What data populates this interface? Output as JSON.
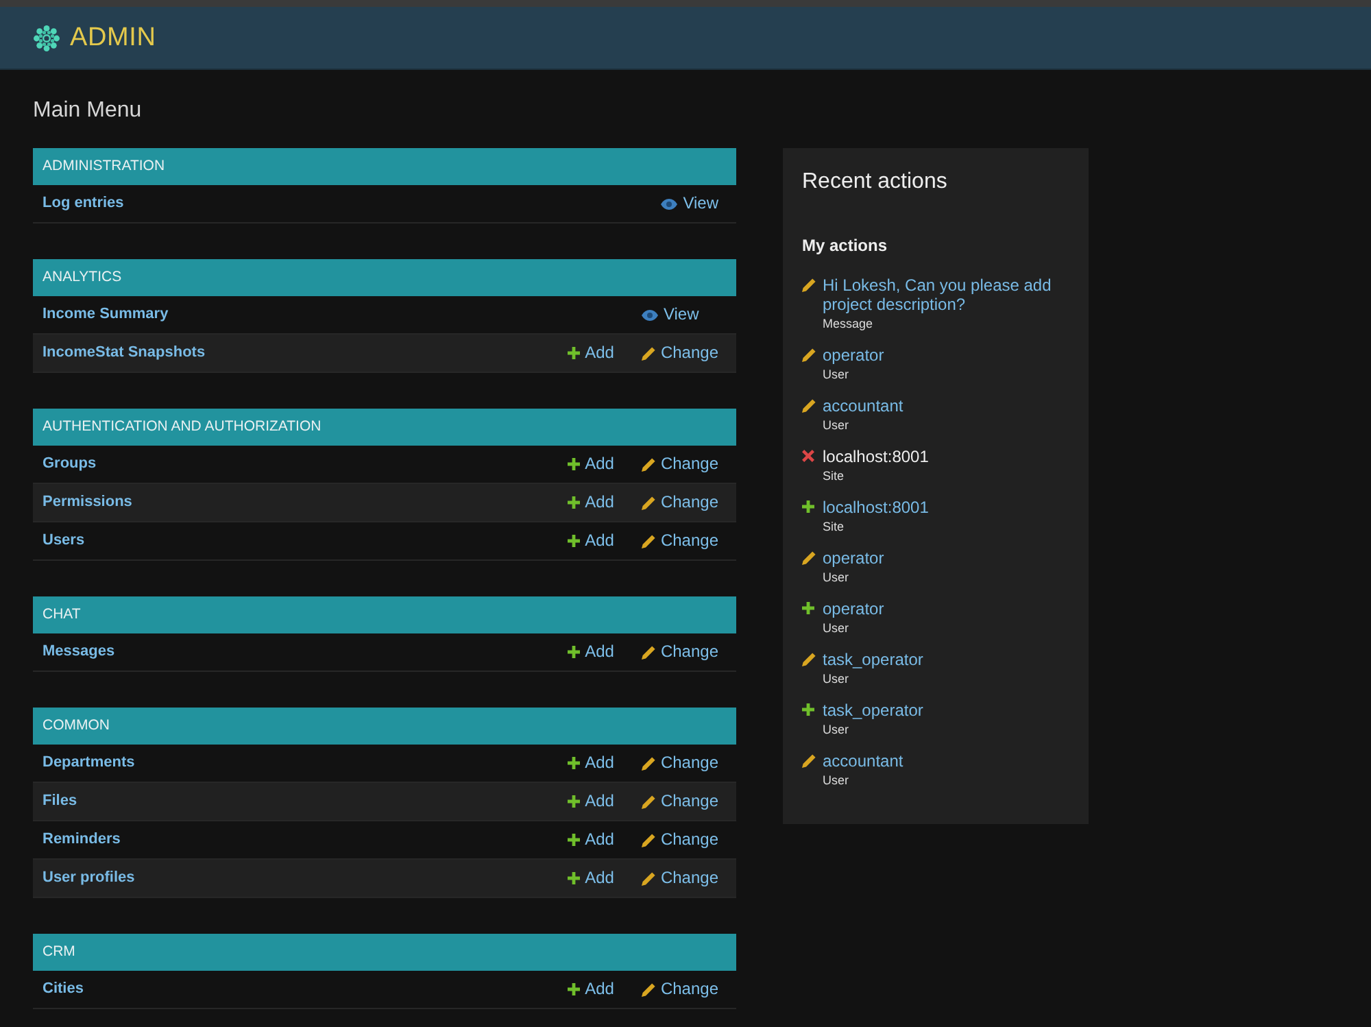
{
  "header": {
    "title": "ADMIN"
  },
  "page_title": "Main Menu",
  "modules": [
    {
      "caption": "ADMINISTRATION",
      "rows": [
        {
          "name": "Log entries",
          "actions": [
            {
              "kind": "view",
              "label": "View"
            }
          ]
        }
      ]
    },
    {
      "caption": "ANALYTICS",
      "rows": [
        {
          "name": "Income Summary",
          "actions": [
            {
              "kind": "view",
              "label": "View"
            }
          ]
        },
        {
          "name": "IncomeStat Snapshots",
          "actions": [
            {
              "kind": "add",
              "label": "Add"
            },
            {
              "kind": "change",
              "label": "Change"
            }
          ]
        }
      ]
    },
    {
      "caption": "AUTHENTICATION AND AUTHORIZATION",
      "rows": [
        {
          "name": "Groups",
          "actions": [
            {
              "kind": "add",
              "label": "Add"
            },
            {
              "kind": "change",
              "label": "Change"
            }
          ]
        },
        {
          "name": "Permissions",
          "actions": [
            {
              "kind": "add",
              "label": "Add"
            },
            {
              "kind": "change",
              "label": "Change"
            }
          ]
        },
        {
          "name": "Users",
          "actions": [
            {
              "kind": "add",
              "label": "Add"
            },
            {
              "kind": "change",
              "label": "Change"
            }
          ]
        }
      ]
    },
    {
      "caption": "CHAT",
      "rows": [
        {
          "name": "Messages",
          "actions": [
            {
              "kind": "add",
              "label": "Add"
            },
            {
              "kind": "change",
              "label": "Change"
            }
          ]
        }
      ]
    },
    {
      "caption": "COMMON",
      "rows": [
        {
          "name": "Departments",
          "actions": [
            {
              "kind": "add",
              "label": "Add"
            },
            {
              "kind": "change",
              "label": "Change"
            }
          ]
        },
        {
          "name": "Files",
          "actions": [
            {
              "kind": "add",
              "label": "Add"
            },
            {
              "kind": "change",
              "label": "Change"
            }
          ]
        },
        {
          "name": "Reminders",
          "actions": [
            {
              "kind": "add",
              "label": "Add"
            },
            {
              "kind": "change",
              "label": "Change"
            }
          ]
        },
        {
          "name": "User profiles",
          "actions": [
            {
              "kind": "add",
              "label": "Add"
            },
            {
              "kind": "change",
              "label": "Change"
            }
          ]
        }
      ]
    },
    {
      "caption": "CRM",
      "rows": [
        {
          "name": "Cities",
          "actions": [
            {
              "kind": "add",
              "label": "Add"
            },
            {
              "kind": "change",
              "label": "Change"
            }
          ]
        }
      ]
    }
  ],
  "recent_actions": {
    "title": "Recent actions",
    "subtitle": "My actions",
    "items": [
      {
        "kind": "change",
        "label": "Hi Lokesh, Can you please add project description?",
        "type": "Message"
      },
      {
        "kind": "change",
        "label": "operator",
        "type": "User"
      },
      {
        "kind": "change",
        "label": "accountant",
        "type": "User"
      },
      {
        "kind": "delete",
        "label": "localhost:8001",
        "type": "Site"
      },
      {
        "kind": "add",
        "label": "localhost:8001",
        "type": "Site"
      },
      {
        "kind": "change",
        "label": "operator",
        "type": "User"
      },
      {
        "kind": "add",
        "label": "operator",
        "type": "User"
      },
      {
        "kind": "change",
        "label": "task_operator",
        "type": "User"
      },
      {
        "kind": "add",
        "label": "task_operator",
        "type": "User"
      },
      {
        "kind": "change",
        "label": "accountant",
        "type": "User"
      }
    ]
  }
}
